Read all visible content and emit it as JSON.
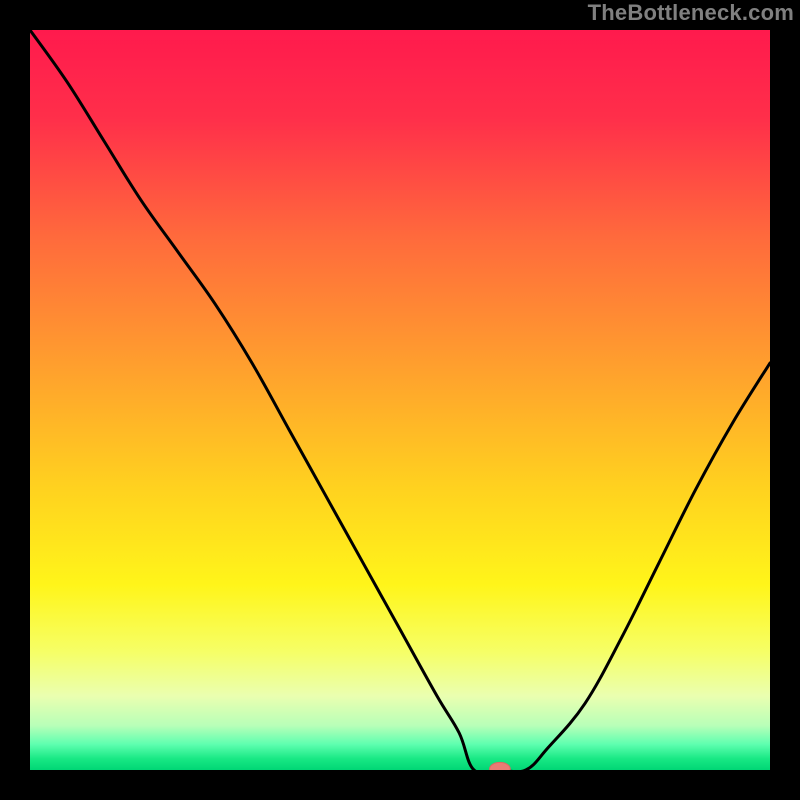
{
  "attribution": "TheBottleneck.com",
  "colors": {
    "black": "#000000",
    "attribution_text": "#808080",
    "curve": "#000000",
    "marker_fill": "#e87b74",
    "marker_stroke": "#d96a63"
  },
  "chart_data": {
    "type": "line",
    "title": "",
    "xlabel": "",
    "ylabel": "",
    "xlim": [
      0,
      100
    ],
    "ylim": [
      0,
      100
    ],
    "grid": false,
    "legend": false,
    "gradient_stops": [
      {
        "offset": 0.0,
        "color": "#ff1a4d"
      },
      {
        "offset": 0.12,
        "color": "#ff2f4a"
      },
      {
        "offset": 0.28,
        "color": "#ff6a3c"
      },
      {
        "offset": 0.45,
        "color": "#ff9e2e"
      },
      {
        "offset": 0.62,
        "color": "#ffd21f"
      },
      {
        "offset": 0.75,
        "color": "#fff51a"
      },
      {
        "offset": 0.84,
        "color": "#f6ff66"
      },
      {
        "offset": 0.9,
        "color": "#eaffb0"
      },
      {
        "offset": 0.94,
        "color": "#b8ffb8"
      },
      {
        "offset": 0.965,
        "color": "#5fffb0"
      },
      {
        "offset": 0.985,
        "color": "#18e884"
      },
      {
        "offset": 1.0,
        "color": "#00d675"
      }
    ],
    "series": [
      {
        "name": "bottleneck-curve",
        "x": [
          0,
          5,
          10,
          15,
          20,
          25,
          30,
          35,
          40,
          45,
          50,
          55,
          58,
          60,
          62,
          65,
          70,
          75,
          80,
          85,
          90,
          95,
          100
        ],
        "y": [
          100,
          93,
          85,
          77,
          70,
          63,
          55,
          46,
          37,
          28,
          19,
          10,
          5,
          2,
          0,
          0,
          3,
          9,
          18,
          28,
          38,
          47,
          55
        ]
      }
    ],
    "flat_bottom": {
      "x_start": 60,
      "x_end": 67,
      "y": 0
    },
    "marker": {
      "x": 63.5,
      "y": 0,
      "rx_pct": 1.4,
      "ry_pct": 0.9
    }
  }
}
